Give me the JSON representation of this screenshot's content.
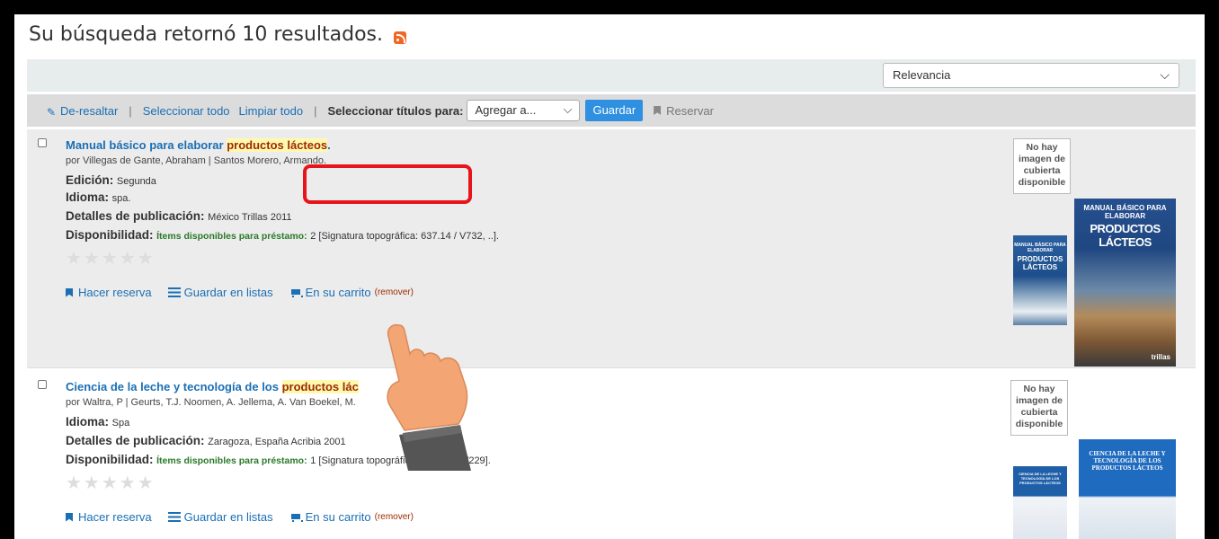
{
  "header": {
    "title": "Su búsqueda retornó 10 resultados."
  },
  "sort": {
    "selected": "Relevancia"
  },
  "toolbar": {
    "unhighlight": "De-resaltar",
    "select_all": "Seleccionar todo",
    "clear_all": "Limpiar todo",
    "select_titles_for": "Seleccionar títulos para:",
    "add_to": "Agregar a...",
    "save": "Guardar",
    "reserve": "Reservar"
  },
  "records": [
    {
      "title_pre": "Manual básico para elaborar ",
      "title_hl": "productos lácteos",
      "title_post": ".",
      "authors": "por Villegas de Gante, Abraham | Santos Morero, Armando.",
      "edition_label": "Edición:",
      "edition": "Segunda",
      "language_label": "Idioma:",
      "language": "spa.",
      "pub_label": "Detalles de publicación:",
      "pub": "México Trillas 2011",
      "avail_label": "Disponibilidad:",
      "avail_green": "Ítems disponibles para préstamo:",
      "avail_rest": "2 [Signatura topográfica: 637.14 / V732, ..].",
      "stars": "★★★★★",
      "hold": "Hacer reserva",
      "save_lists": "Guardar en listas",
      "cart": "En su carrito",
      "remove": "(remover)",
      "nocover": "No hay imagen de cubierta disponible",
      "cover_small_title": "PRODUCTOS LÁCTEOS",
      "cover_small_sub": "MANUAL BÁSICO PARA ELABORAR",
      "cover_big_title": "PRODUCTOS LÁCTEOS",
      "cover_big_sub": "MANUAL BÁSICO PARA ELABORAR",
      "cover_big_pub": "trillas"
    },
    {
      "title_pre": "Ciencia de la leche y tecnología de los ",
      "title_hl": "productos lác",
      "authors": "por Waltra, P | Geurts, T.J. Noomen, A. Jellema, A. Van Boekel, M.",
      "language_label": "Idioma:",
      "language": "Spa",
      "pub_label": "Detalles de publicación:",
      "pub": "Zaragoza, España Acribia 2001",
      "avail_label": "Disponibilidad:",
      "avail_green": "Ítems disponibles para préstamo:",
      "avail_rest": "1 [Signatura topográfica: 637.14 / W229].",
      "stars": "★★★★★",
      "hold": "Hacer reserva",
      "save_lists": "Guardar en listas",
      "cart": "En su carrito",
      "remove": "(remover)",
      "nocover": "No hay imagen de cubierta disponible",
      "cover_title": "CIENCIA DE LA LECHE Y TECNOLOGÍA DE LOS PRODUCTOS LÁCTEOS",
      "cover_small_title": "CIENCIA DE LA LECHE Y TECNOLOGÍA DE LOS PRODUCTOS LÁCTEOS"
    }
  ],
  "colors": {
    "link": "#1a6fb5",
    "highlight_box": "#e8141b",
    "save_button": "#2f8fe0",
    "available": "#2a7a2a"
  }
}
